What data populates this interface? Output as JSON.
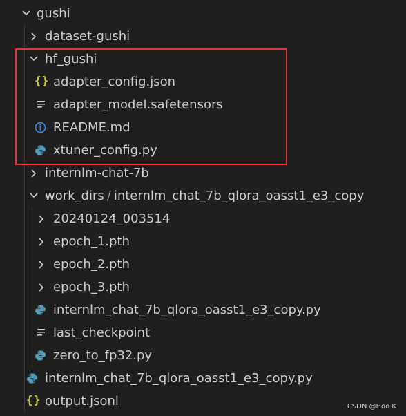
{
  "explorer": {
    "items": [
      {
        "label": "gushi",
        "kind": "folder",
        "expanded": true,
        "icon": "chevron-down-icon"
      },
      {
        "label": "dataset-gushi",
        "kind": "folder",
        "expanded": false,
        "icon": "chevron-right-icon"
      },
      {
        "label": "hf_gushi",
        "kind": "folder",
        "expanded": true,
        "icon": "chevron-down-icon"
      },
      {
        "label": "adapter_config.json",
        "kind": "file",
        "icon": "json-braces-icon"
      },
      {
        "label": "adapter_model.safetensors",
        "kind": "file",
        "icon": "text-lines-icon"
      },
      {
        "label": "README.md",
        "kind": "file",
        "icon": "info-icon"
      },
      {
        "label": "xtuner_config.py",
        "kind": "file",
        "icon": "python-icon"
      },
      {
        "label": "internlm-chat-7b",
        "kind": "folder",
        "expanded": false,
        "icon": "chevron-right-icon"
      },
      {
        "label": "work_dirs",
        "label_suffix": "internlm_chat_7b_qlora_oasst1_e3_copy",
        "separator": "/",
        "kind": "folder",
        "expanded": true,
        "icon": "chevron-down-icon"
      },
      {
        "label": "20240124_003514",
        "kind": "folder",
        "expanded": false,
        "icon": "chevron-right-icon"
      },
      {
        "label": "epoch_1.pth",
        "kind": "folder",
        "expanded": false,
        "icon": "chevron-right-icon"
      },
      {
        "label": "epoch_2.pth",
        "kind": "folder",
        "expanded": false,
        "icon": "chevron-right-icon"
      },
      {
        "label": "epoch_3.pth",
        "kind": "folder",
        "expanded": false,
        "icon": "chevron-right-icon"
      },
      {
        "label": "internlm_chat_7b_qlora_oasst1_e3_copy.py",
        "kind": "file",
        "icon": "python-icon"
      },
      {
        "label": "last_checkpoint",
        "kind": "file",
        "icon": "text-lines-icon"
      },
      {
        "label": "zero_to_fp32.py",
        "kind": "file",
        "icon": "python-icon"
      },
      {
        "label": "internlm_chat_7b_qlora_oasst1_e3_copy.py",
        "kind": "file",
        "icon": "python-icon"
      },
      {
        "label": "output.jsonl",
        "kind": "file",
        "icon": "json-braces-icon"
      }
    ],
    "json_glyph": "{}",
    "colors": {
      "background": "#1f1f1f",
      "text": "#cccccc",
      "json_icon": "#cbcb41",
      "info_icon": "#3b8eea",
      "python_icon": "#519aba",
      "highlight_box": "#e5383b"
    }
  },
  "watermark": "CSDN @Hoo K"
}
